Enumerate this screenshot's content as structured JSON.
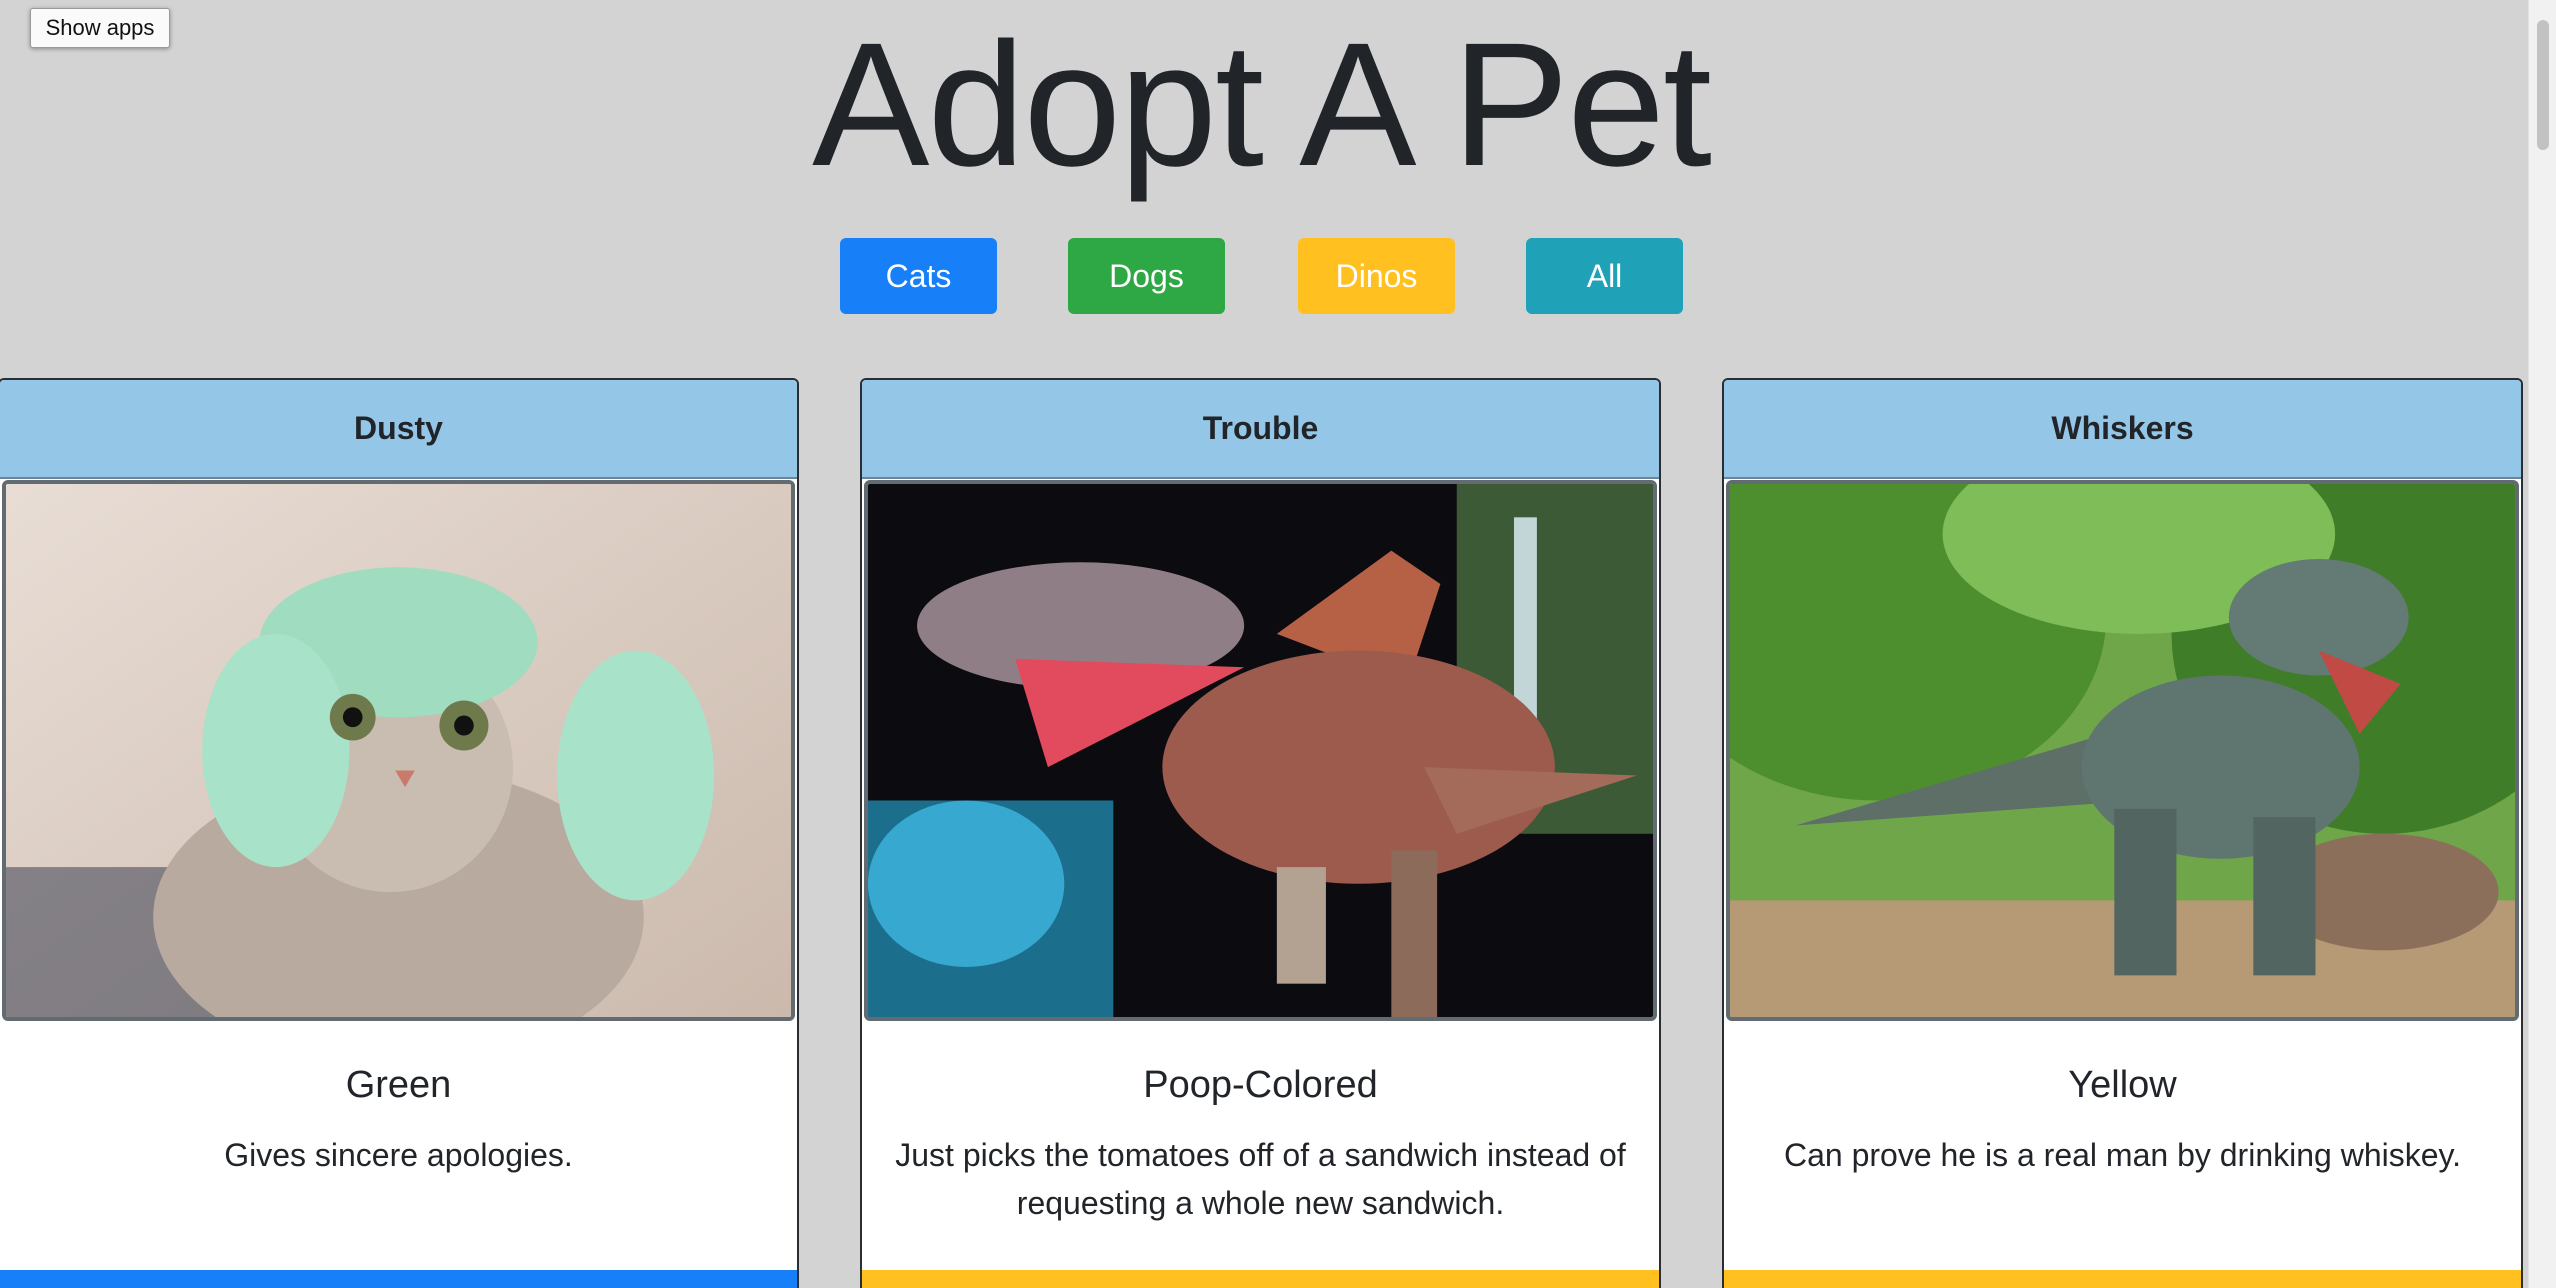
{
  "toolbar": {
    "show_apps_label": "Show apps"
  },
  "header": {
    "title": "Adopt A Pet"
  },
  "filters": [
    {
      "label": "Cats",
      "color": "#1780f8"
    },
    {
      "label": "Dogs",
      "color": "#2ea745"
    },
    {
      "label": "Dinos",
      "color": "#ffc020"
    },
    {
      "label": "All",
      "color": "#1fa2b8"
    }
  ],
  "cards": [
    {
      "name": "Dusty",
      "color": "Green",
      "description": "Gives sincere apologies.",
      "image_icon": "cat-photo",
      "footer_color": "#1780f8"
    },
    {
      "name": "Trouble",
      "color": "Poop-Colored",
      "description": "Just picks the tomatoes off of a sandwich instead of requesting a whole new sandwich.",
      "image_icon": "dinosaur-photo",
      "footer_color": "#ffc020"
    },
    {
      "name": "Whiskers",
      "color": "Yellow",
      "description": "Can prove he is a real man by drinking whiskey.",
      "image_icon": "dinosaur-photo",
      "footer_color": "#ffc020"
    }
  ]
}
